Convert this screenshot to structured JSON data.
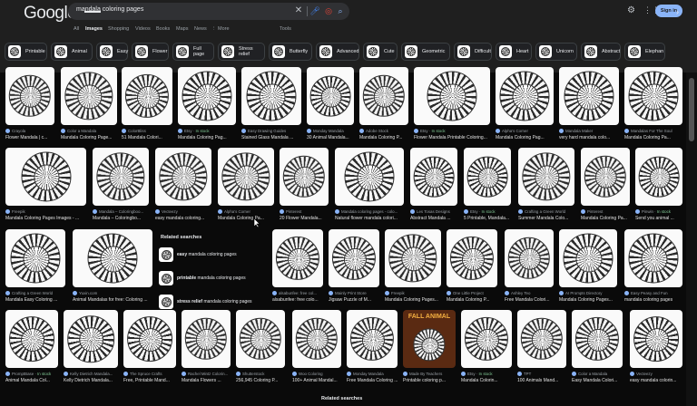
{
  "header": {
    "logo": "Google",
    "query": "mandala coloring pages",
    "signin_label": "Sign in"
  },
  "tabs": [
    "All",
    "Images",
    "Shopping",
    "Videos",
    "Books",
    "Maps",
    "News",
    "⋮ More",
    "Tools"
  ],
  "active_tab": "Images",
  "chips": [
    "Printable",
    "Animal",
    "Easy",
    "Flower",
    "Full page",
    "Stress relief",
    "Butterfly",
    "Advanced",
    "Cute",
    "Geometric",
    "Difficult",
    "Heart",
    "Unicorn",
    "Abstract",
    "Elephan"
  ],
  "rows": [
    {
      "cards": [
        {
          "source": "Crayola",
          "title": "Flower Mandala | c..."
        },
        {
          "source": "Color a Mandala",
          "title": "Mandala Coloring Page..."
        },
        {
          "source": "ColorBliss",
          "title": "51 Mandala Colori..."
        },
        {
          "source": "Etsy",
          "stock": "In stock",
          "title": "Mandala Coloring Pag..."
        },
        {
          "source": "Easy Drawing Guides",
          "title": "Stained Glass Mandala ..."
        },
        {
          "source": "Monday Mandala",
          "title": "30 Animal Mandala..."
        },
        {
          "source": "Adobe Stock",
          "title": "Mandala Coloring P..."
        },
        {
          "source": "Etsy",
          "stock": "In stock",
          "title": "Flower Mandala Printable Coloring..."
        },
        {
          "source": "Alpha's Corner",
          "title": "Mandala Coloring Pag..."
        },
        {
          "source": "Mandala Maker",
          "title": "very hard mandala colo..."
        },
        {
          "source": "Mandalas For The Soul",
          "title": "Mandala Coloring Pa..."
        }
      ]
    },
    {
      "cards": [
        {
          "source": "Freepik",
          "title": "Mandala Coloring Pages Images - ..."
        },
        {
          "source": "Mandala – Coloringboo...",
          "title": "Mandala – Coloringbo..."
        },
        {
          "source": "Vecteezy",
          "title": "easy mandala coloring..."
        },
        {
          "source": "Alpha's Corner",
          "title": "Mandala Coloring Pa..."
        },
        {
          "source": "Pinterest",
          "title": "20 Flower Mandala..."
        },
        {
          "source": "Mandala coloring pages - colo...",
          "title": "Natural flower mandala colori..."
        },
        {
          "source": "Les Tosas Designs",
          "title": "Abstract Mandala ..."
        },
        {
          "source": "Etsy",
          "stock": "In stock",
          "title": "5 Printable, Mandala..."
        },
        {
          "source": "Crafting a Green World",
          "title": "Summer Mandala Colo..."
        },
        {
          "source": "Pinterest",
          "title": "Mandala Coloring Pa..."
        },
        {
          "source": "Pinwin",
          "stock": "In stock",
          "title": "Send you animal ..."
        }
      ]
    },
    {
      "cards": [
        {
          "source": "Crafting a Green World",
          "title": "Mandala Easy Coloring ..."
        },
        {
          "source": "Yuxin.com",
          "title": "Animal Mandalas for free: Coloring ..."
        },
        {
          "source": "alsabunfee: free col...",
          "title": "alsabunfee: free colo..."
        },
        {
          "source": "Mainly Print Store",
          "title": "Jigsaw Puzzle of M..."
        },
        {
          "source": "Freepik",
          "title": "Mandala Coloring Pages..."
        },
        {
          "source": "One Little Project",
          "title": "Mandala Coloring P..."
        },
        {
          "source": "Ashley Teo",
          "title": "Free Mandala Colori..."
        },
        {
          "source": "AI Prompts Directory",
          "title": "Mandala Coloring Pages..."
        },
        {
          "source": "Easy Peasy and Fun",
          "title": "mandala coloring pages"
        }
      ]
    },
    {
      "cards": [
        {
          "source": "PromptBase",
          "stock": "In stock",
          "title": "Animal Mandala Col..."
        },
        {
          "source": "Kelly Dietrich Mandala...",
          "title": "Kelly Dietrich Mandala..."
        },
        {
          "source": "The Spruce Crafts",
          "title": "Free, Printable Mand..."
        },
        {
          "source": "Rachel Mintz Colorin...",
          "title": "Mandala Flowers ..."
        },
        {
          "source": "Shutterstock",
          "title": "256,945 Coloring P..."
        },
        {
          "source": "Woo Coloring",
          "title": "100+ Animal Mandal..."
        },
        {
          "source": "Monday Mandala",
          "title": "Free Mandala Coloring ..."
        },
        {
          "source": "Made By Teachers",
          "title": "Printable coloring p..."
        },
        {
          "source": "Etsy",
          "stock": "In stock",
          "title": "Mandala Colorin..."
        },
        {
          "source": "TPT",
          "title": "100 Animals Mand..."
        },
        {
          "source": "Color a Mandala",
          "title": "Easy Mandala Colori..."
        },
        {
          "source": "Vecteezy",
          "title": "easy mandala colorin..."
        }
      ]
    }
  ],
  "related_searches": {
    "heading": "Related searches",
    "items": [
      {
        "bold": "easy",
        "rest": "mandala coloring pages"
      },
      {
        "bold": "printable",
        "rest": "mandala coloring pages"
      },
      {
        "bold": "stress relief",
        "rest": "mandala coloring pages"
      }
    ]
  },
  "related_searches_bottom": {
    "heading": "Related searches"
  },
  "banner_text": "FALL ANIMAL"
}
